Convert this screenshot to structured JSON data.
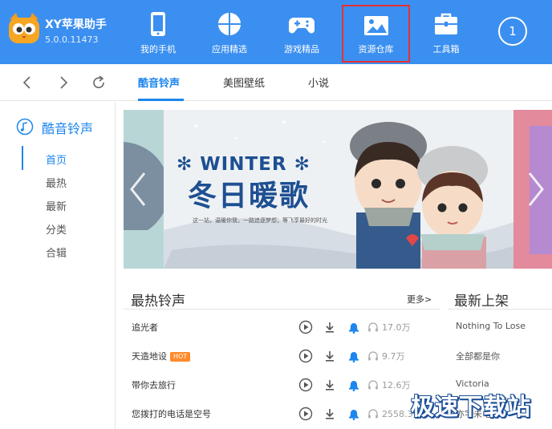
{
  "app": {
    "name": "XY苹果助手",
    "version": "5.0.0.11473"
  },
  "top_nav": [
    {
      "label": "我的手机",
      "icon": "phone-icon"
    },
    {
      "label": "应用精选",
      "icon": "apps-icon"
    },
    {
      "label": "游戏精品",
      "icon": "gamepad-icon"
    },
    {
      "label": "资源仓库",
      "icon": "image-icon",
      "active": true
    },
    {
      "label": "工具箱",
      "icon": "toolbox-icon"
    }
  ],
  "notification_count": "1",
  "sub_tabs": [
    {
      "label": "酷音铃声",
      "active": true
    },
    {
      "label": "美图壁纸"
    },
    {
      "label": "小说"
    }
  ],
  "sidebar": {
    "header": "酷音铃声",
    "items": [
      {
        "label": "首页",
        "active": true
      },
      {
        "label": "最热"
      },
      {
        "label": "最新"
      },
      {
        "label": "分类"
      },
      {
        "label": "合辑"
      }
    ]
  },
  "banner": {
    "title_en": "✻ WINTER ✻",
    "title_cn": "冬日暖歌",
    "slogan": "这一站，温暖你我，一路追逐梦想；等飞享最好的时光"
  },
  "hot_section": {
    "title": "最热铃声",
    "more": "更多>",
    "rows": [
      {
        "name": "追光者",
        "hot": "",
        "count": "17.0万"
      },
      {
        "name": "天造地设",
        "hot": "HOT",
        "count": "9.7万"
      },
      {
        "name": "带你去旅行",
        "hot": "",
        "count": "12.6万"
      },
      {
        "name": "您拨打的电话是空号",
        "hot": "",
        "count": "2558.3万"
      }
    ]
  },
  "new_section": {
    "title": "最新上架",
    "items": [
      "Nothing To Lose",
      "全部都是你",
      "Victoria",
      "亦字未电"
    ]
  },
  "watermark": "极速下载站",
  "colors": {
    "topbar": "#3b8ff0",
    "accent": "#1c86ee",
    "active_outline": "#e8302f",
    "hot_badge": "#ff8a2b"
  }
}
